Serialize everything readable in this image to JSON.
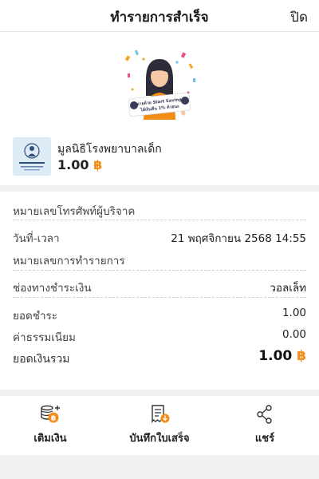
{
  "header": {
    "title": "ทำรายการสำเร็จ",
    "close_label": "ปิด"
  },
  "hero": {
    "banner_line1": "จ่ายด้วย Start Saving",
    "banner_line2": "ได้เงินคืน 1% ด้วยนะ"
  },
  "merchant": {
    "name": "มูลนิธิโรงพยาบาลเด็ก",
    "amount": "1.00",
    "currency_symbol": "฿"
  },
  "details": {
    "donor_phone_label": "หมายเลขโทรศัพท์ผู้บริจาค",
    "datetime_label": "วันที่-เวลา",
    "datetime_value": "21 พฤศจิกายน 2568 14:55",
    "txn_id_label": "หมายเลขการทำรายการ",
    "channel_label": "ช่องทางชำระเงิน",
    "channel_value": "วอลเล็ท",
    "pay_amount_label": "ยอดชำระ",
    "pay_amount_value": "1.00",
    "fee_label": "ค่าธรรมเนียม",
    "fee_value": "0.00",
    "total_label": "ยอดเงินรวม",
    "total_value": "1.00",
    "currency_symbol": "฿"
  },
  "actions": [
    {
      "label": "เติมเงิน",
      "icon": "coins-plus-icon"
    },
    {
      "label": "บันทึกใบเสร็จ",
      "icon": "receipt-download-icon"
    },
    {
      "label": "แชร์",
      "icon": "share-icon"
    }
  ],
  "colors": {
    "accent": "#f28c16",
    "divider": "#f1f1f3"
  }
}
